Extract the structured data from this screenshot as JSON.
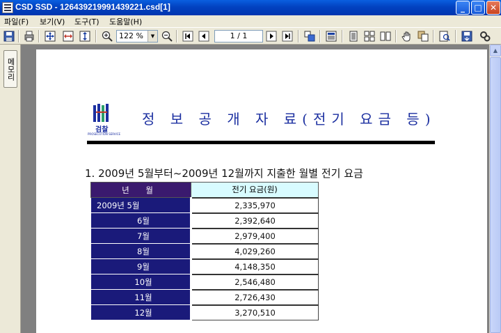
{
  "window": {
    "title": "CSD SSD - 126439219991439221.csd[1]",
    "minimize": "_",
    "maximize": "□",
    "close": "✕"
  },
  "menu": {
    "file": "파일(F)",
    "view": "보기(V)",
    "tools": "도구(T)",
    "help": "도움말(H)"
  },
  "toolbar": {
    "zoom": "122 %",
    "page": "1 / 1"
  },
  "sidebar": {
    "tab_label": "메모리"
  },
  "document": {
    "logo_text": "검찰",
    "logo_sub": "PROSECUTION SERVICE",
    "header_title": "정 보 공 개 자 료(전기 요금 등)",
    "section_heading": "1. 2009년 5월부터~2009년 12월까지 지출한 월별 전기 요금",
    "table": {
      "col_month": "년 월",
      "col_cost": "전기 요금(원)",
      "rows": [
        {
          "month": "2009년  5월",
          "cost": "2,335,970"
        },
        {
          "month": "6월",
          "cost": "2,392,640"
        },
        {
          "month": "7월",
          "cost": "2,979,400"
        },
        {
          "month": "8월",
          "cost": "4,029,260"
        },
        {
          "month": "9월",
          "cost": "4,148,350"
        },
        {
          "month": "10월",
          "cost": "2,546,480"
        },
        {
          "month": "11월",
          "cost": "2,726,430"
        },
        {
          "month": "12월",
          "cost": "3,270,510"
        }
      ]
    }
  },
  "colors": {
    "title_blue": "#1b2fa0",
    "header_purple": "#3a1a6e",
    "month_navy": "#1a1a7a",
    "cost_header": "#d8fbff"
  }
}
